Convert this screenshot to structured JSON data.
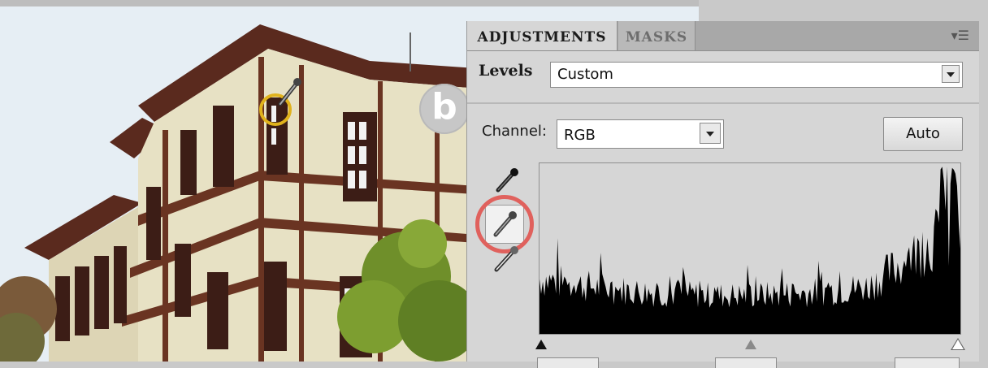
{
  "panel": {
    "tabs": [
      {
        "label": "ADJUSTMENTS",
        "active": true
      },
      {
        "label": "MASKS",
        "active": false
      }
    ],
    "menu_icon": "panel-menu-icon",
    "adjustment_name": "Levels",
    "preset_value": "Custom",
    "channel_label": "Channel:",
    "channel_value": "RGB",
    "auto_label": "Auto",
    "eyedroppers": [
      "black-point-eyedropper-icon",
      "gray-point-eyedropper-icon",
      "white-point-eyedropper-icon"
    ],
    "selected_eyedropper": "gray-point-eyedropper-icon"
  },
  "annotations": {
    "marker_letter": "b",
    "highlight_color": "#e0615d",
    "target_circle_color": "#e0b21c"
  },
  "colors": {
    "panel_bg": "#d6d6d6",
    "tab_strip": "#a8a8a8",
    "histogram_fill": "#000000"
  }
}
